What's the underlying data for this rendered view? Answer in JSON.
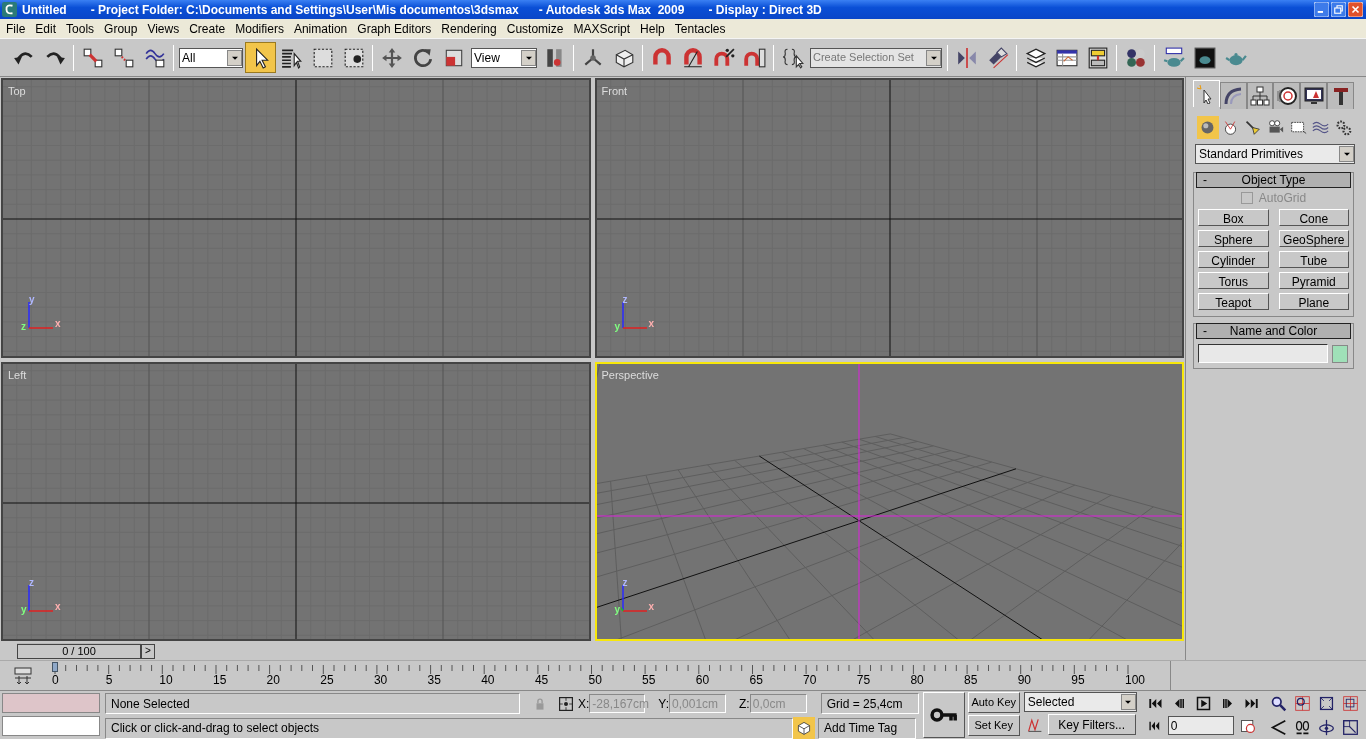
{
  "title_bar": {
    "title": "Untitled",
    "project": "- Project Folder: C:\\Documents and Settings\\User\\Mis documentos\\3dsmax",
    "app": "- Autodesk 3ds Max  2009",
    "display": "- Display : Direct 3D"
  },
  "menu": [
    "File",
    "Edit",
    "Tools",
    "Group",
    "Views",
    "Create",
    "Modifiers",
    "Animation",
    "Graph Editors",
    "Rendering",
    "Customize",
    "MAXScript",
    "Help",
    "Tentacles"
  ],
  "toolbar": {
    "groups": [
      [
        {
          "kind": "button",
          "selected": false
        },
        {
          "kind": "button",
          "selected": false
        }
      ],
      [
        {
          "kind": "button",
          "selected": false
        },
        {
          "kind": "button",
          "selected": false
        },
        {
          "kind": "button",
          "selected": false
        }
      ],
      [
        {
          "kind": "dropdown",
          "value": "All"
        },
        {
          "kind": "button",
          "selected": true
        },
        {
          "kind": "button",
          "selected": false
        },
        {
          "kind": "button",
          "selected": false
        },
        {
          "kind": "button",
          "selected": false
        }
      ],
      [
        {
          "kind": "button",
          "selected": false
        },
        {
          "kind": "button",
          "selected": false
        },
        {
          "kind": "button",
          "selected": false
        },
        {
          "kind": "dropdown",
          "value": "View"
        },
        {
          "kind": "button",
          "selected": false
        }
      ],
      [
        {
          "kind": "button",
          "selected": false
        },
        {
          "kind": "button",
          "selected": false
        }
      ],
      [
        {
          "kind": "button",
          "selected": false
        },
        {
          "kind": "button",
          "selected": false
        },
        {
          "kind": "button",
          "selected": false
        },
        {
          "kind": "button",
          "selected": false
        }
      ],
      [
        {
          "kind": "button",
          "selected": false
        },
        {
          "kind": "combo",
          "placeholder": "Create Selection Set"
        }
      ],
      [
        {
          "kind": "button",
          "selected": false
        },
        {
          "kind": "button",
          "selected": false
        }
      ],
      [
        {
          "kind": "button",
          "selected": false
        },
        {
          "kind": "button",
          "selected": false
        },
        {
          "kind": "button",
          "selected": false
        }
      ],
      [
        {
          "kind": "button",
          "selected": false
        }
      ],
      [
        {
          "kind": "button",
          "selected": false
        },
        {
          "kind": "button",
          "selected": false
        },
        {
          "kind": "button",
          "selected": false
        }
      ]
    ]
  },
  "viewports": [
    {
      "label": "Top",
      "kind": "ortho",
      "active": false,
      "axis_labels": [
        "y",
        "z",
        "x"
      ]
    },
    {
      "label": "Front",
      "kind": "ortho",
      "active": false,
      "axis_labels": [
        "z",
        "y",
        "x"
      ]
    },
    {
      "label": "Left",
      "kind": "ortho",
      "active": false,
      "axis_labels": [
        "z",
        "y",
        "x"
      ]
    },
    {
      "label": "Perspective",
      "kind": "perspective",
      "active": true,
      "axis_labels": [
        "z",
        "y",
        "x"
      ]
    }
  ],
  "time_slider": {
    "value": "0 / 100",
    "next": ">",
    "level": 0
  },
  "track_bar": {
    "numbers": [
      "0",
      "5",
      "10",
      "15",
      "20",
      "25",
      "30",
      "35",
      "40",
      "45",
      "50",
      "55",
      "60",
      "65",
      "70",
      "75",
      "80",
      "85",
      "90",
      "95",
      "100"
    ]
  },
  "status_bar": {
    "selection": "None Selected",
    "prompt": "Click or click-and-drag to select objects",
    "x_label": "X:",
    "x": "-28,167cm",
    "y_label": "Y:",
    "y": "0,001cm",
    "z_label": "Z:",
    "z": "0,0cm",
    "grid": "Grid = 25,4cm",
    "time_tag": "Add Time Tag"
  },
  "animation": {
    "auto_key": "Auto Key",
    "set_key": "Set Key",
    "key_mode": "Selected",
    "key_filters": "Key Filters...",
    "frame": "0"
  },
  "command_panel": {
    "tabs": [
      {
        "selected": true
      },
      {
        "selected": false
      },
      {
        "selected": false
      },
      {
        "selected": false
      },
      {
        "selected": false
      },
      {
        "selected": false
      }
    ],
    "categories": [
      {
        "selected": true
      },
      {
        "selected": false
      },
      {
        "selected": false
      },
      {
        "selected": false
      },
      {
        "selected": false
      },
      {
        "selected": false
      },
      {
        "selected": false
      }
    ],
    "dropdown": "Standard Primitives",
    "object_type": {
      "title": "Object Type",
      "collapse": "-",
      "autogrid": {
        "label": "AutoGrid",
        "checked": false,
        "disabled": true
      },
      "buttons": [
        "Box",
        "Cone",
        "Sphere",
        "GeoSphere",
        "Cylinder",
        "Tube",
        "Torus",
        "Pyramid",
        "Teapot",
        "Plane"
      ]
    },
    "name_and_color": {
      "title": "Name and Color",
      "collapse": "-",
      "color": "#9fe0b8"
    }
  }
}
